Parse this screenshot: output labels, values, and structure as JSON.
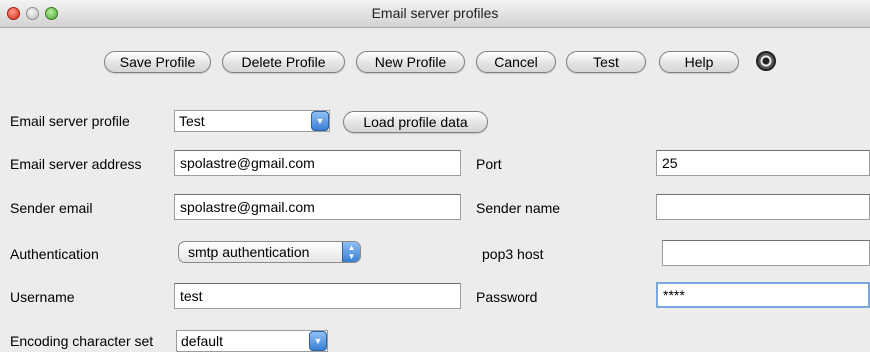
{
  "window": {
    "title": "Email server profiles"
  },
  "toolbar": {
    "save_label": "Save Profile",
    "delete_label": "Delete Profile",
    "new_label": "New Profile",
    "cancel_label": "Cancel",
    "test_label": "Test",
    "help_label": "Help",
    "settings_icon": "gear-icon"
  },
  "form": {
    "profile": {
      "label": "Email server profile",
      "value": "Test",
      "load_button": "Load profile data"
    },
    "server_address": {
      "label": "Email server address",
      "value": "spolastre@gmail.com"
    },
    "port": {
      "label": "Port",
      "value": "25"
    },
    "sender_email": {
      "label": "Sender email",
      "value": "spolastre@gmail.com"
    },
    "sender_name": {
      "label": "Sender name",
      "value": ""
    },
    "authentication": {
      "label": "Authentication",
      "value": "smtp authentication"
    },
    "pop3_host": {
      "label": "pop3 host",
      "value": ""
    },
    "username": {
      "label": "Username",
      "value": "test"
    },
    "password": {
      "label": "Password",
      "value": "****"
    },
    "encoding": {
      "label": "Encoding character set",
      "value": "default"
    }
  }
}
